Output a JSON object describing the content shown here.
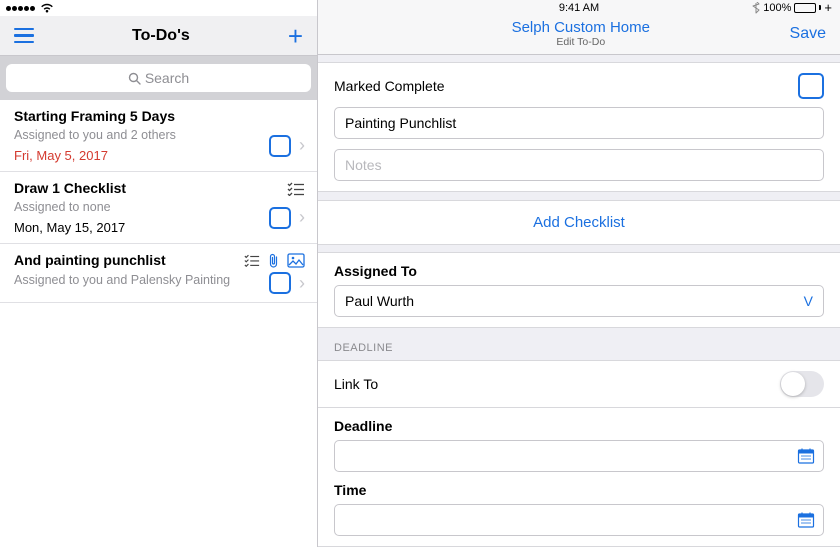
{
  "status": {
    "time": "9:41 AM",
    "battery_pct": "100%"
  },
  "left": {
    "title": "To-Do's",
    "search_placeholder": "Search",
    "items": [
      {
        "title": "Starting Framing 5 Days",
        "assigned": "Assigned to you and 2 others",
        "date": "Fri, May 5, 2017",
        "date_red": true,
        "has_checklist_icon": false,
        "has_attach_icon": false,
        "has_image_icon": false
      },
      {
        "title": "Draw 1 Checklist",
        "assigned": "Assigned to none",
        "date": "Mon, May 15, 2017",
        "date_red": false,
        "has_checklist_icon": true,
        "has_attach_icon": false,
        "has_image_icon": false
      },
      {
        "title": "And painting punchlist",
        "assigned": "Assigned to you and Palensky Painting",
        "date": "",
        "date_red": false,
        "has_checklist_icon": true,
        "has_attach_icon": true,
        "has_image_icon": true
      }
    ]
  },
  "right": {
    "header_title": "Selph Custom Home",
    "header_sub": "Edit To-Do",
    "save_label": "Save",
    "marked_complete_label": "Marked Complete",
    "title_value": "Painting Punchlist",
    "notes_placeholder": "Notes",
    "add_checklist_label": "Add Checklist",
    "assigned_to_label": "Assigned To",
    "assigned_to_value": "Paul Wurth",
    "deadline_group": "DEADLINE",
    "link_to_label": "Link To",
    "deadline_label": "Deadline",
    "time_label": "Time"
  }
}
